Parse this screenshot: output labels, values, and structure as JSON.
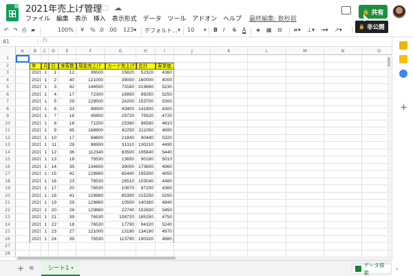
{
  "header": {
    "doc_title": "2021年売上げ管理",
    "star_icon": "☆",
    "folder_icon": "🗀",
    "cloud_icon": "☁",
    "menu": [
      "ファイル",
      "編集",
      "表示",
      "挿入",
      "表示形式",
      "データ",
      "ツール",
      "アドオン",
      "ヘルプ"
    ],
    "last_edit": "最終編集: 数秒前",
    "share_label": "共有",
    "tooltip_label": "非公開",
    "accent_color": "#1e8e3e"
  },
  "toolbar": {
    "zoom": "100%",
    "currency": "¥",
    "percent": "%",
    "decimal_less": ".0",
    "decimal_more": ".00",
    "number_format": "123▾",
    "font_family": "デフォルト...",
    "font_size": "10",
    "bold": "B",
    "italic": "I",
    "strike": "S",
    "text_color": "A"
  },
  "formula_bar": {
    "cell_ref": "A1",
    "fx": "fx"
  },
  "columns": [
    "A",
    "B",
    "C",
    "D",
    "E",
    "F",
    "G",
    "H",
    "I",
    "J",
    "K",
    "L",
    "M",
    "N",
    "O"
  ],
  "table": {
    "headers": [
      "年",
      "月",
      "日",
      "来客数",
      "現金売上げ",
      "カード売上げ",
      "合計",
      "客単価"
    ],
    "rows": [
      [
        "2021",
        "1",
        "1",
        "12",
        "36500",
        "15820",
        "52320",
        "4360"
      ],
      [
        "2021",
        "1",
        "2",
        "40",
        "121000",
        "39000",
        "160000",
        "4000"
      ],
      [
        "2021",
        "1",
        "3",
        "42",
        "146500",
        "73160",
        "219660",
        "5230"
      ],
      [
        "2021",
        "1",
        "4",
        "17",
        "72300",
        "16950",
        "89250",
        "5250"
      ],
      [
        "2021",
        "1",
        "5",
        "29",
        "129500",
        "24200",
        "153700",
        "5300"
      ],
      [
        "2021",
        "1",
        "6",
        "33",
        "98500",
        "43400",
        "141900",
        "4300"
      ],
      [
        "2021",
        "1",
        "7",
        "16",
        "45800",
        "29720",
        "75520",
        "4720"
      ],
      [
        "2021",
        "1",
        "8",
        "18",
        "71200",
        "15380",
        "86580",
        "4810"
      ],
      [
        "2021",
        "1",
        "9",
        "45",
        "168800",
        "42250",
        "211050",
        "4690"
      ],
      [
        "2021",
        "1",
        "10",
        "17",
        "68600",
        "21840",
        "90440",
        "5320"
      ],
      [
        "2021",
        "1",
        "11",
        "29",
        "98900",
        "31310",
        "130210",
        "4490"
      ],
      [
        "2021",
        "1",
        "12",
        "36",
        "112340",
        "83500",
        "195840",
        "5440"
      ],
      [
        "2021",
        "1",
        "13",
        "18",
        "76530",
        "13650",
        "90180",
        "5010"
      ],
      [
        "2021",
        "1",
        "14",
        "35",
        "134600",
        "39000",
        "173600",
        "4960"
      ],
      [
        "2021",
        "1",
        "15",
        "42",
        "129860",
        "65440",
        "195300",
        "4650"
      ],
      [
        "2021",
        "1",
        "16",
        "23",
        "76530",
        "26510",
        "103040",
        "4480"
      ],
      [
        "2021",
        "1",
        "17",
        "20",
        "76530",
        "10670",
        "87200",
        "4360"
      ],
      [
        "2021",
        "1",
        "18",
        "41",
        "129860",
        "85390",
        "215250",
        "5250"
      ],
      [
        "2021",
        "1",
        "19",
        "29",
        "129860",
        "10500",
        "140360",
        "4840"
      ],
      [
        "2021",
        "1",
        "20",
        "28",
        "129860",
        "22740",
        "152600",
        "5450"
      ],
      [
        "2021",
        "1",
        "21",
        "39",
        "76530",
        "108720",
        "185250",
        "4750"
      ],
      [
        "2021",
        "1",
        "22",
        "18",
        "76530",
        "17790",
        "94320",
        "5240"
      ],
      [
        "2021",
        "1",
        "23",
        "27",
        "121000",
        "13190",
        "134190",
        "4970"
      ],
      [
        "2021",
        "1",
        "24",
        "39",
        "76530",
        "113790",
        "190320",
        "4880"
      ]
    ]
  },
  "row_numbers": [
    "1",
    "2",
    "3",
    "4",
    "5",
    "6",
    "7",
    "8",
    "9",
    "10",
    "11",
    "12",
    "13",
    "14",
    "15",
    "16",
    "17",
    "18",
    "19",
    "20",
    "21",
    "22",
    "23",
    "24",
    "25",
    "26",
    "27",
    "28"
  ],
  "bottom": {
    "add_sheet": "+",
    "all_sheets": "≡",
    "sheet_name": "シート1",
    "sheet_caret": "▾",
    "explore_label": "データ探索"
  }
}
